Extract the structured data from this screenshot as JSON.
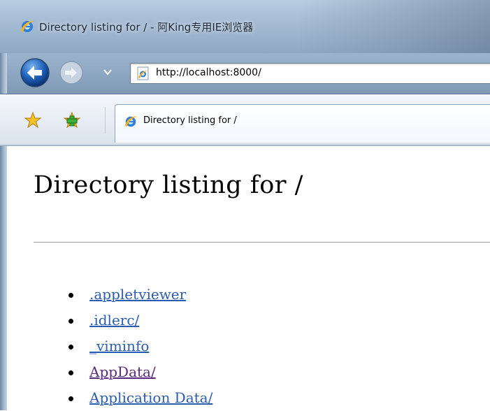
{
  "window": {
    "title": "Directory listing for / - 阿King专用IE浏览器"
  },
  "navigation": {
    "address_url": "http://localhost:8000/"
  },
  "tabs": [
    {
      "label": "Directory listing for /",
      "active": true
    }
  ],
  "page": {
    "title": "Directory listing for /",
    "entries": [
      {
        "name": ".appletviewer",
        "visited": false
      },
      {
        "name": ".idlerc/",
        "visited": false
      },
      {
        "name": "_viminfo",
        "visited": false
      },
      {
        "name": "AppData/",
        "visited": true
      },
      {
        "name": "Application Data/",
        "visited": false
      }
    ]
  },
  "colors": {
    "link": "#2a5db0",
    "visited_link": "#5a2a82",
    "glass": "#9fb6cf"
  },
  "icons": {
    "title": "ie-logo-icon",
    "back": "back-arrow-icon",
    "forward": "forward-arrow-icon",
    "dropdown": "chevron-down-icon",
    "page": "ie-page-icon",
    "favorites": "favorites-star-icon",
    "add_favorite": "add-favorites-icon",
    "tab": "ie-logo-icon"
  }
}
